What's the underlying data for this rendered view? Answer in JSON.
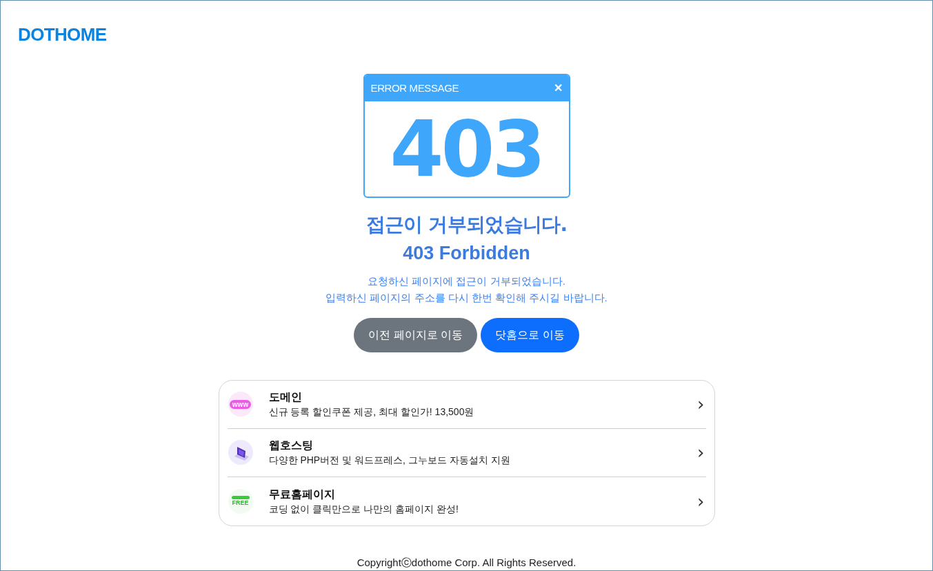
{
  "logo": "DOTHOME",
  "error_window": {
    "title": "ERROR MESSAGE",
    "close": "✕",
    "code": "403"
  },
  "heading": "접근이 거부되었습니다.",
  "subheading": "403 Forbidden",
  "message": [
    "요청하신 페이지에 접근이 거부되었습니다.",
    "입력하신 페이지의 주소를 다시 한번 확인해 주시길 바랍니다."
  ],
  "buttons": [
    {
      "label": "이전 페이지로 이동",
      "kind": "secondary"
    },
    {
      "label": "닷홈으로 이동",
      "kind": "primary"
    }
  ],
  "services": [
    {
      "kind": "www",
      "icon_text": "www",
      "title": "도메인",
      "description": "신규 등록 할인쿠폰 제공, 최대 할인가! 13,500원",
      "chevron": "›"
    },
    {
      "kind": "laptop",
      "title": "웹호스팅",
      "description": "다양한 PHP버전 및 워드프레스, 그누보드 자동설치 지원",
      "chevron": "›"
    },
    {
      "kind": "free",
      "icon_text": "FREE",
      "title": "무료홈페이지",
      "description": "코딩 없이 클릭만으로 나만의 홈페이지 완성!",
      "chevron": "›"
    }
  ],
  "footer": "Copyrightⓒdothome Corp. All Rights Reserved."
}
